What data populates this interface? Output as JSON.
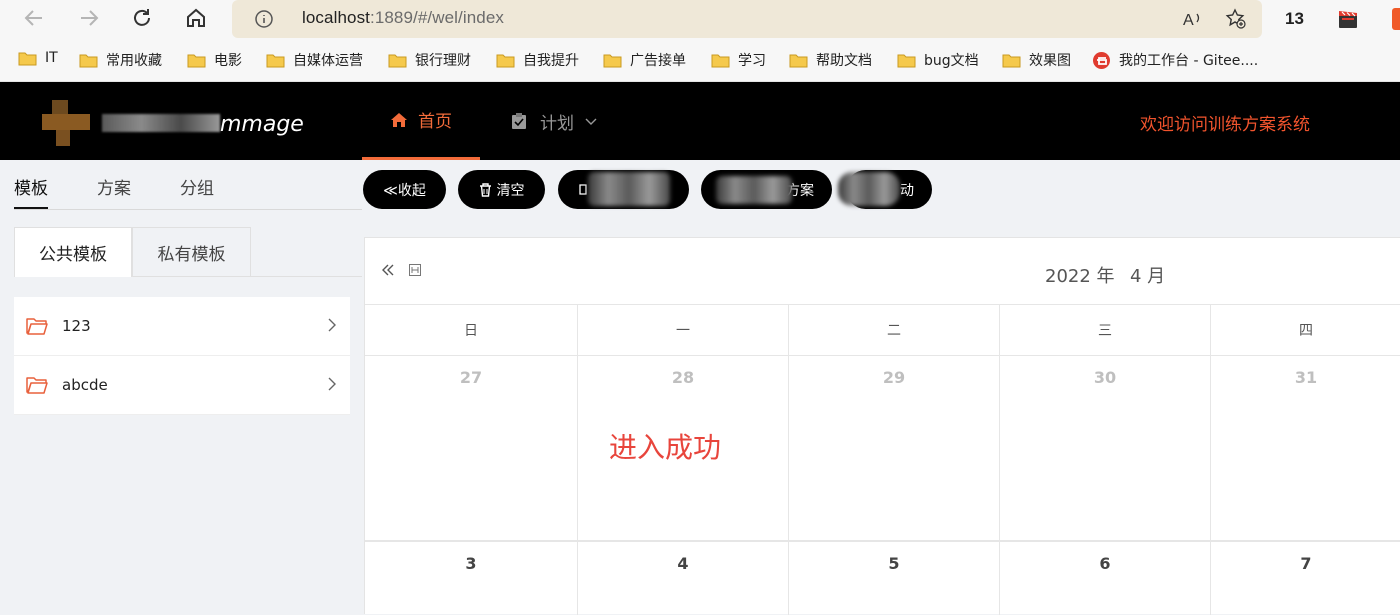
{
  "browser": {
    "url_host": "localhost",
    "url_path": ":1889/#/wel/index",
    "extension_count": "13",
    "bookmarks": [
      {
        "label": "IT"
      },
      {
        "label": "常用收藏"
      },
      {
        "label": "电影"
      },
      {
        "label": "自媒体运营"
      },
      {
        "label": "银行理财"
      },
      {
        "label": "自我提升"
      },
      {
        "label": "广告接单"
      },
      {
        "label": "学习"
      },
      {
        "label": "帮助文档"
      },
      {
        "label": "bug文档"
      },
      {
        "label": "效果图"
      },
      {
        "label": "我的工作台 - Gitee...."
      }
    ]
  },
  "header": {
    "logo_text": "mmage",
    "nav": {
      "home": "首页",
      "plan": "计划"
    },
    "welcome": "欢迎访问训练方案系统"
  },
  "sidebar": {
    "tabs": [
      "模板",
      "方案",
      "分组"
    ],
    "sub_tabs": [
      "公共模板",
      "私有模板"
    ],
    "folders": [
      {
        "label": "123"
      },
      {
        "label": "abcde"
      }
    ]
  },
  "toolbar": {
    "collapse": "≪收起",
    "clear": "清空",
    "btn3_fragment": "",
    "btn4_fragment": "方案",
    "btn5_fragment": "动"
  },
  "calendar": {
    "year": "2022 年",
    "month": "4 月",
    "weekdays": [
      "日",
      "一",
      "二",
      "三",
      "四"
    ],
    "row1": [
      "27",
      "28",
      "29",
      "30",
      "31"
    ],
    "row2": [
      "3",
      "4",
      "5",
      "6",
      "7"
    ],
    "message": "进入成功"
  },
  "colors": {
    "accent": "#f26b3a",
    "welcome": "#f2542d",
    "success": "#e8453c"
  }
}
